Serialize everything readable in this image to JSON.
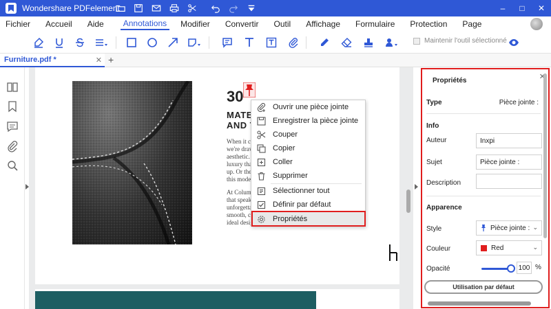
{
  "app": {
    "title": "Wondershare PDFelement",
    "window_controls": [
      "–",
      "□",
      "✕"
    ]
  },
  "menu": {
    "items": [
      "Fichier",
      "Accueil",
      "Aide",
      "Annotations",
      "Modifier",
      "Convertir",
      "Outil",
      "Affichage",
      "Formulaire",
      "Protection",
      "Page"
    ],
    "active": "Annotations"
  },
  "toolbar": {
    "keep_tool_label": "Maintenir l'outil sélectionné"
  },
  "tab": {
    "label": "Furniture.pdf *",
    "close": "✕",
    "add": "+"
  },
  "document": {
    "number": "30",
    "heading_line1": "MATERI",
    "heading_line2": "AND TR",
    "paragraph1": [
      "When it come",
      "we're drawn t",
      "aesthetic. Ima",
      "luxury that se",
      "up. Or the wa",
      "this modern"
    ],
    "paragraph2": [
      "At Columbia",
      "that speaks y",
      "unforgettable",
      "smooth, com",
      "ideal design."
    ]
  },
  "context_menu": {
    "items": [
      {
        "label": "Ouvrir une pièce jointe",
        "icon": "attach-open-icon"
      },
      {
        "label": "Enregistrer la pièce jointe",
        "icon": "save-icon"
      },
      {
        "label": "Couper",
        "icon": "scissors-icon"
      },
      {
        "label": "Copier",
        "icon": "copy-icon"
      },
      {
        "label": "Coller",
        "icon": "paste-icon"
      },
      {
        "label": "Supprimer",
        "icon": "trash-icon"
      },
      {
        "label": "Sélectionner tout",
        "icon": "select-all-icon"
      },
      {
        "label": "Définir par défaut",
        "icon": "checkbox-icon"
      },
      {
        "label": "Propriétés",
        "icon": "gear-icon"
      }
    ],
    "highlighted": "Propriétés"
  },
  "properties": {
    "title": "Propriétés",
    "close": "✕",
    "type_label": "Type",
    "type_value": "Pièce jointe :",
    "info_section": "Info",
    "author_label": "Auteur",
    "author_value": "Inxpi",
    "subject_label": "Sujet",
    "subject_value": "Pièce jointe :",
    "description_label": "Description",
    "description_value": "",
    "appearance_section": "Apparence",
    "style_label": "Style",
    "style_value": "Pièce jointe :",
    "color_label": "Couleur",
    "color_value": "Red",
    "color_hex": "#e01d1d",
    "opacity_label": "Opacité",
    "opacity_value": "100",
    "opacity_unit": "%",
    "opacity_fraction": 1.0,
    "default_button": "Utilisation par défaut"
  },
  "colors": {
    "accent": "#2f58d6",
    "highlight_red": "#e01d1d",
    "teal": "#1d5e62"
  }
}
